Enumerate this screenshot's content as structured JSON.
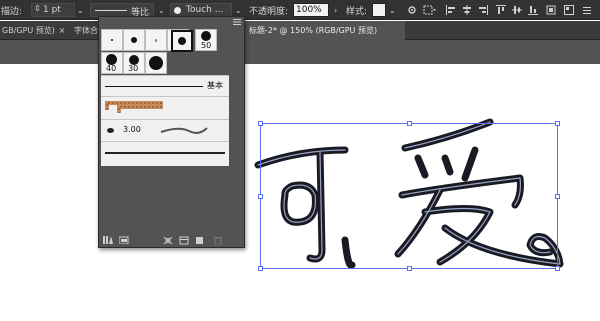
{
  "control_bar": {
    "stroke_label": "描边:",
    "stroke_weight": "1 pt",
    "profile_label": "等比",
    "brush_label": "Touch ...",
    "opacity_label": "不透明度:",
    "opacity_value": "100%",
    "style_label": "样式:"
  },
  "tabs": [
    {
      "label": "GB/GPU 预览)"
    },
    {
      "label": "字体合"
    },
    {
      "label": "标题-2* @ 150% (RGB/GPU 预览)"
    }
  ],
  "brush_panel": {
    "sizes": [
      "50",
      "40",
      "30"
    ],
    "basic_label": "基本",
    "bristle_size": "3.00"
  },
  "artwork": {
    "text": "可爱",
    "stroke_color": "#1a1a24"
  },
  "colors": {
    "selection": "#5b6df2",
    "panel_bg": "#535353",
    "bar_bg": "#323232"
  }
}
